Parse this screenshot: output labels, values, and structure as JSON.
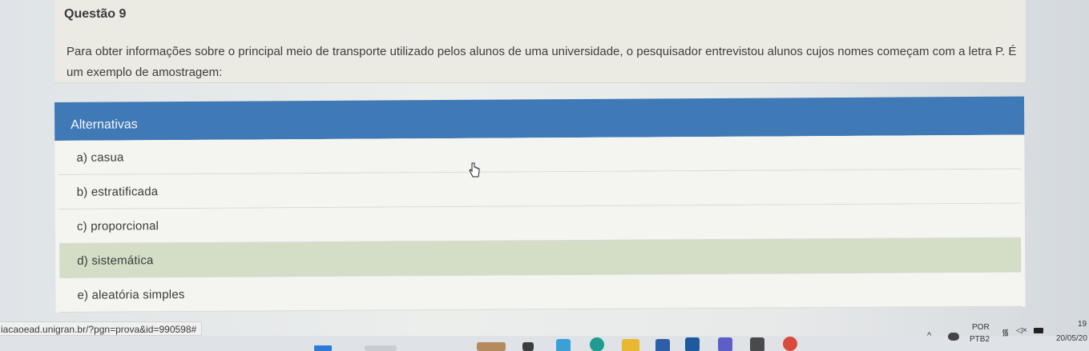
{
  "question": {
    "title": "Questão 9",
    "text": "Para obter informações sobre o principal meio de transporte utilizado pelos alunos de uma universidade, o pesquisador entrevistou alunos cujos nomes começam com a letra P. É um exemplo de amostragem:"
  },
  "alternatives": {
    "header": "Alternativas",
    "items": [
      {
        "label": "a) casua",
        "selected": false
      },
      {
        "label": "b) estratificada",
        "selected": false
      },
      {
        "label": "c) proporcional",
        "selected": false
      },
      {
        "label": "d) sistemática",
        "selected": true
      },
      {
        "label": "e) aleatória simples",
        "selected": false
      }
    ]
  },
  "status_bar": {
    "url": "iacaoead.unigran.br/?pgn=prova&id=990598#"
  },
  "taskbar": {
    "language_top": "POR",
    "language_bottom": "PTB2",
    "time": "19",
    "date": "20/05/20"
  },
  "colors": {
    "header_blue": "#3f79b6",
    "selected_green": "#d4ddc6"
  }
}
